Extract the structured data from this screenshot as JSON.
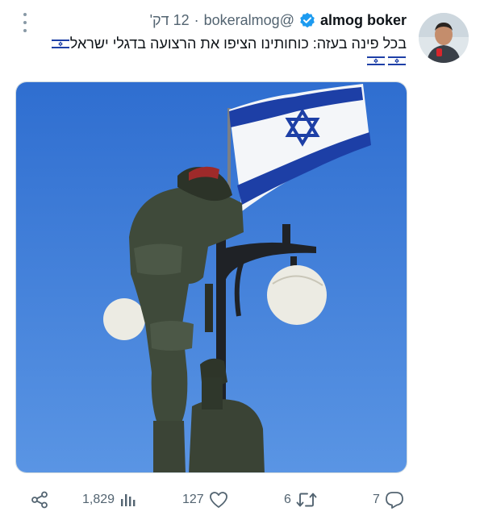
{
  "tweet": {
    "author_name": "almog boker",
    "author_handle": "@bokeralmog",
    "separator": "·",
    "time": "12 דק'",
    "text": "בכל פינה בעזה: כוחותינו הציפו את הרצועה בדגלי ישראל",
    "verified_color": "#1d9bf0"
  },
  "media": {
    "sky_color": "#3f7fd6",
    "flag_blue": "#1d3fa6"
  },
  "actions": {
    "share_icon": "share-icon",
    "views": "1,829",
    "likes": "127",
    "retweets": "6",
    "replies": "7"
  },
  "colors": {
    "muted": "#536471",
    "text": "#0f1419"
  }
}
